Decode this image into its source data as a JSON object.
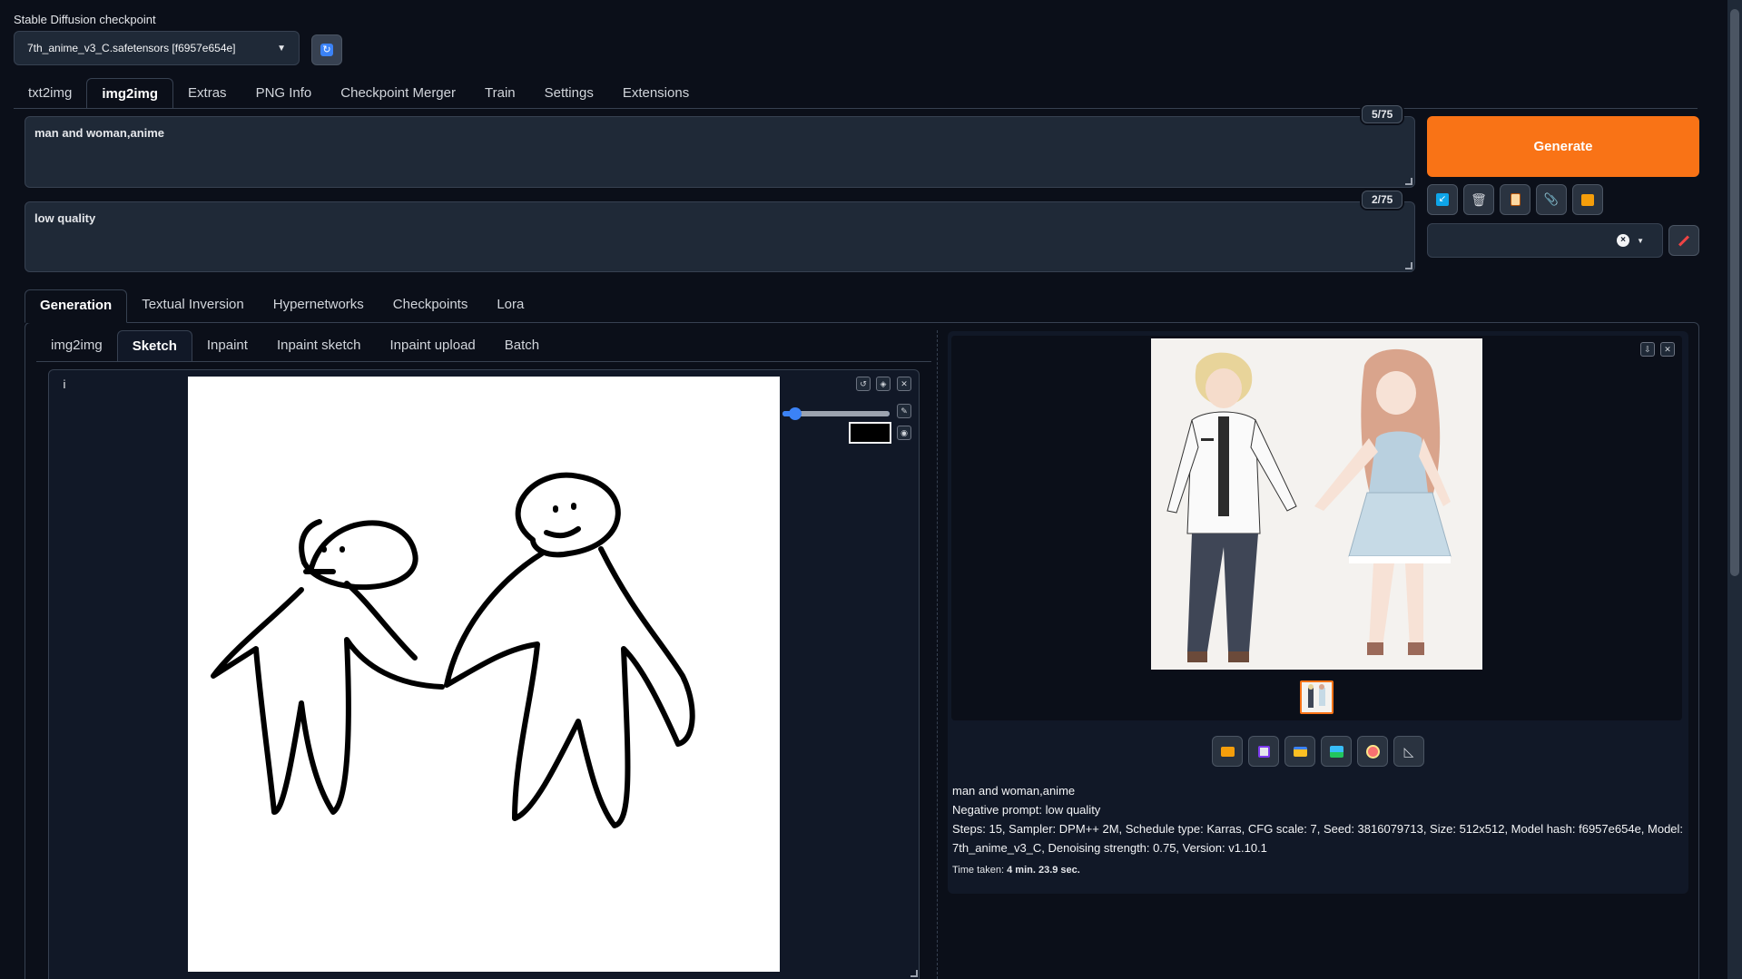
{
  "checkpoint": {
    "label": "Stable Diffusion checkpoint",
    "value": "7th_anime_v3_C.safetensors [f6957e654e]"
  },
  "main_tabs": [
    {
      "label": "txt2img"
    },
    {
      "label": "img2img"
    },
    {
      "label": "Extras"
    },
    {
      "label": "PNG Info"
    },
    {
      "label": "Checkpoint Merger"
    },
    {
      "label": "Train"
    },
    {
      "label": "Settings"
    },
    {
      "label": "Extensions"
    }
  ],
  "prompt": {
    "value": "man and woman,anime",
    "counter": "5/75"
  },
  "negative_prompt": {
    "value": "low quality",
    "counter": "2/75"
  },
  "generate": {
    "label": "Generate"
  },
  "style_select": {
    "value": ""
  },
  "gen_tabs": [
    {
      "label": "Generation"
    },
    {
      "label": "Textual Inversion"
    },
    {
      "label": "Hypernetworks"
    },
    {
      "label": "Checkpoints"
    },
    {
      "label": "Lora"
    }
  ],
  "mode_tabs": [
    {
      "label": "img2img"
    },
    {
      "label": "Sketch"
    },
    {
      "label": "Inpaint"
    },
    {
      "label": "Inpaint sketch"
    },
    {
      "label": "Inpaint upload"
    },
    {
      "label": "Batch"
    }
  ],
  "sketch": {
    "info_icon": "i",
    "brush_size": 0.12,
    "brush_color": "#000000"
  },
  "output": {
    "prompt_line": "man and woman,anime",
    "negative_line": "Negative prompt: low quality",
    "params_line_1": "Steps: 15, Sampler: DPM++ 2M, Schedule type: Karras, CFG scale: 7, Seed: 3816079713, Size: 512x512, Model hash: f6957e654e, Model:",
    "params_line_2": "7th_anime_v3_C, Denoising strength: 0.75, Version: v1.10.1",
    "time_label": "Time taken:",
    "time_value": "4 min. 23.9 sec."
  },
  "colors": {
    "accent": "#f97316",
    "background": "#0b0f19",
    "panel": "#111827"
  }
}
